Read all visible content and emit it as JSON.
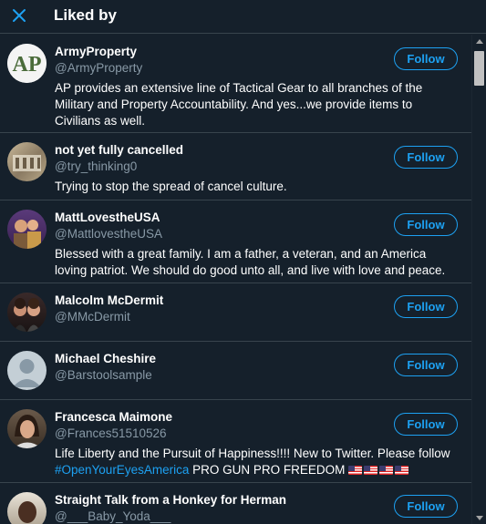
{
  "header": {
    "title": "Liked by",
    "close_icon": "close-icon"
  },
  "users": [
    {
      "name": "ArmyProperty",
      "handle": "@ArmyProperty",
      "bio": "AP provides an extensive line of Tactical Gear to all branches of the Military and Property Accountability. And yes...we provide items to Civilians as well.",
      "avatar_text": "AP",
      "follow_label": "Follow"
    },
    {
      "name": "not yet fully cancelled",
      "handle": "@try_thinking0",
      "bio": "Trying to stop the spread of cancel culture.",
      "follow_label": "Follow"
    },
    {
      "name": "MattLovestheUSA",
      "handle": "@MattlovestheUSA",
      "bio": "Blessed with a great family. I am a father, a veteran, and an America loving patriot. We should do good unto all, and live with love and peace.",
      "follow_label": "Follow"
    },
    {
      "name": "Malcolm McDermit",
      "handle": "@MMcDermit",
      "bio": "",
      "follow_label": "Follow"
    },
    {
      "name": "Michael Cheshire",
      "handle": "@Barstoolsample",
      "bio": "",
      "follow_label": "Follow"
    },
    {
      "name": "Francesca Maimone",
      "handle": "@Frances51510526",
      "bio_line1": "Life Liberty and the Pursuit of Happiness!!!! New to Twitter. Please follow",
      "bio_hashtag": "#OpenYourEyesAmerica",
      "bio_line2_rest": " PRO GUN PRO FREEDOM ",
      "follow_label": "Follow"
    },
    {
      "name": "Straight Talk from a Honkey for Herman",
      "handle": "@___Baby_Yoda___",
      "bio": "",
      "follow_label": "Follow"
    }
  ],
  "colors": {
    "background": "#15202b",
    "accent": "#1da1f2",
    "secondary_text": "#8899a6",
    "divider": "#38444d"
  }
}
